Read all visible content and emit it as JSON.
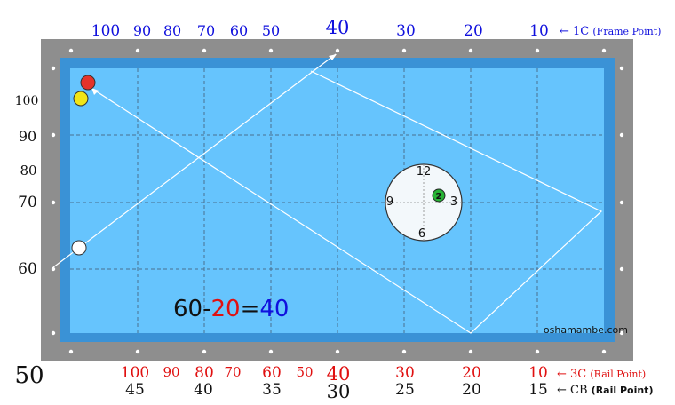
{
  "colors": {
    "frame": "#8e8e8e",
    "cushion": "#3a92d6",
    "cloth": "#66c4fd",
    "grid": "#4a6f90",
    "path": "#ffffff",
    "blue_text": "#1010dd",
    "red_text": "#e01010",
    "ball_red": "#e5332a",
    "ball_yellow": "#f2e516",
    "ball_white": "#ffffff",
    "target_ball": "#27b335"
  },
  "top_scale": {
    "values": [
      "100",
      "90",
      "80",
      "70",
      "60",
      "50",
      "40",
      "30",
      "20",
      "10"
    ],
    "legend": "← 1C",
    "legend_note": "(Frame Point)"
  },
  "left_scale": {
    "values": [
      "100",
      "90",
      "80",
      "70",
      "60"
    ],
    "corner": "50"
  },
  "bottom_rail_scale": {
    "values": [
      "100",
      "90",
      "80",
      "70",
      "60",
      "50",
      "40",
      "30",
      "20",
      "10"
    ],
    "legend": "← 3C",
    "legend_note": "(Rail Point)"
  },
  "bottom_cb_scale": {
    "values": [
      "45",
      "40",
      "35",
      "30",
      "25",
      "20",
      "15"
    ],
    "legend": "← CB",
    "legend_note": "(Rail Point)"
  },
  "formula": {
    "a": "60",
    "op1": "-",
    "b": "20",
    "op2": "=",
    "c": "40"
  },
  "clock": {
    "n12": "12",
    "n3": "3",
    "n6": "6",
    "n9": "9",
    "ball_label": "2"
  },
  "watermark": "oshamambe.com",
  "icons": {
    "arrowhead": "arrowhead-icon"
  }
}
